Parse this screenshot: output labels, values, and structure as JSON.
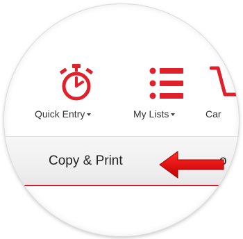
{
  "toolbar": {
    "quick_entry": {
      "label": "Quick Entry",
      "icon": "stopwatch-icon"
    },
    "my_lists": {
      "label": "My Lists",
      "icon": "list-icon"
    },
    "cart": {
      "label": "Car",
      "icon": "cart-icon"
    }
  },
  "nav": {
    "copy_print": "Copy & Print",
    "next_partial": "o"
  },
  "colors": {
    "accent_red": "#e0202b",
    "nav_line_red": "#cc1f2d",
    "text": "#333333"
  }
}
